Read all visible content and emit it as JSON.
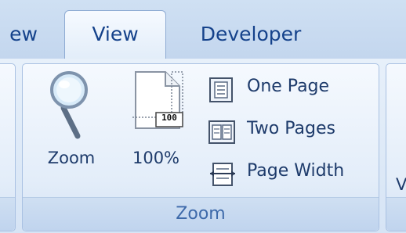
{
  "tabs": {
    "review_partial": "ew",
    "view": "View",
    "developer": "Developer"
  },
  "zoom_group": {
    "caption": "Zoom",
    "zoom_button": "Zoom",
    "percent_button": "100%",
    "percent_icon_text": "100",
    "one_page": "One Page",
    "two_pages": "Two Pages",
    "page_width": "Page Width"
  },
  "right_group": {
    "partial_label": "V"
  },
  "colors": {
    "tab_text": "#15428b",
    "label_text": "#1e3b6b",
    "caption_text": "#3e6aaa"
  }
}
